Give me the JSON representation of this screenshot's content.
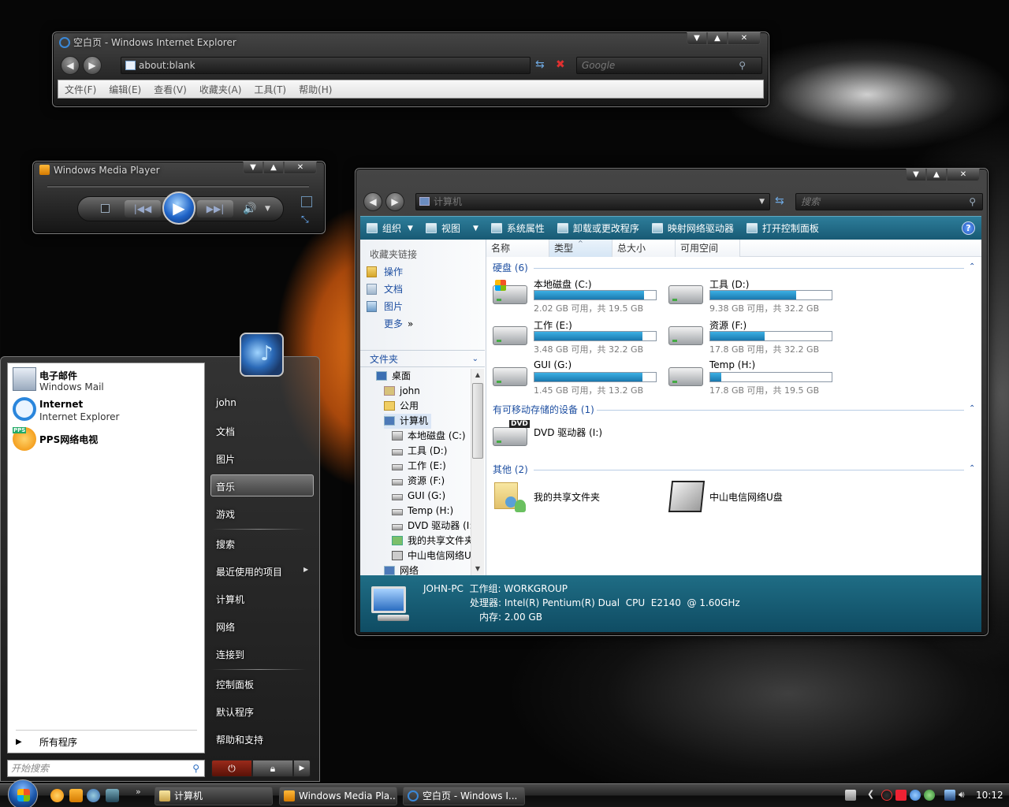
{
  "ie": {
    "title": "空白页 - Windows Internet Explorer",
    "address": "about:blank",
    "search_placeholder": "Google",
    "menu": [
      "文件(F)",
      "编辑(E)",
      "查看(V)",
      "收藏夹(A)",
      "工具(T)",
      "帮助(H)"
    ]
  },
  "wmp": {
    "title": "Windows Media Player"
  },
  "explorer": {
    "address": "计算机",
    "search_placeholder": "搜索",
    "commands": [
      "组织",
      "视图",
      "系统属性",
      "卸载或更改程序",
      "映射网络驱动器",
      "打开控制面板"
    ],
    "favorites_header": "收藏夹链接",
    "favorites": [
      "操作",
      "文档",
      "图片",
      "更多"
    ],
    "folders_header": "文件夹",
    "tree": [
      "桌面",
      "john",
      "公用",
      "计算机",
      "本地磁盘 (C:)",
      "工具 (D:)",
      "工作 (E:)",
      "资源 (F:)",
      "GUI (G:)",
      "Temp (H:)",
      "DVD 驱动器 (I:)",
      "我的共享文件夹",
      "中山电信网络U盘",
      "网络"
    ],
    "columns": [
      "名称",
      "类型",
      "总大小",
      "可用空间"
    ],
    "groups": {
      "hdd": "硬盘 (6)",
      "removable": "有可移动存储的设备 (1)",
      "other": "其他 (2)"
    },
    "drives": [
      {
        "name": "本地磁盘 (C:)",
        "info": "2.02 GB 可用，共 19.5 GB",
        "used": 0.9
      },
      {
        "name": "工具 (D:)",
        "info": "9.38 GB 可用，共 32.2 GB",
        "used": 0.71
      },
      {
        "name": "工作 (E:)",
        "info": "3.48 GB 可用，共 32.2 GB",
        "used": 0.89
      },
      {
        "name": "资源 (F:)",
        "info": "17.8 GB 可用，共 32.2 GB",
        "used": 0.45
      },
      {
        "name": "GUI (G:)",
        "info": "1.45 GB 可用，共 13.2 GB",
        "used": 0.89
      },
      {
        "name": "Temp (H:)",
        "info": "17.8 GB 可用，共 19.5 GB",
        "used": 0.09
      }
    ],
    "dvd": "DVD 驱动器 (I:)",
    "dvd_label": "DVD",
    "others": [
      "我的共享文件夹",
      "中山电信网络U盘"
    ],
    "details": {
      "name_line": "JOHN-PC  工作组: WORKGROUP",
      "cpu_line": "处理器: Intel(R) Pentium(R) Dual  CPU  E2140  @ 1.60GHz",
      "mem_line": "内存: 2.00 GB"
    }
  },
  "start_menu": {
    "pinned": [
      {
        "title": "电子邮件",
        "sub": "Windows Mail"
      },
      {
        "title": "Internet",
        "sub": "Internet Explorer"
      },
      {
        "title": "PPS网络电视",
        "sub": ""
      }
    ],
    "all_programs": "所有程序",
    "search_placeholder": "开始搜索",
    "right": [
      "john",
      "文档",
      "图片",
      "音乐",
      "游戏",
      "搜索",
      "最近使用的项目",
      "计算机",
      "网络",
      "连接到",
      "控制面板",
      "默认程序",
      "帮助和支持"
    ],
    "pps_badge": "PPS"
  },
  "taskbar": {
    "buttons": [
      "计算机",
      "Windows Media Pla...",
      "空白页 - Windows I..."
    ],
    "clock": "10:12"
  },
  "colors": {
    "accent": "#1f6d85",
    "bar_fill": "#1a78ae",
    "link": "#1e4fa1"
  }
}
